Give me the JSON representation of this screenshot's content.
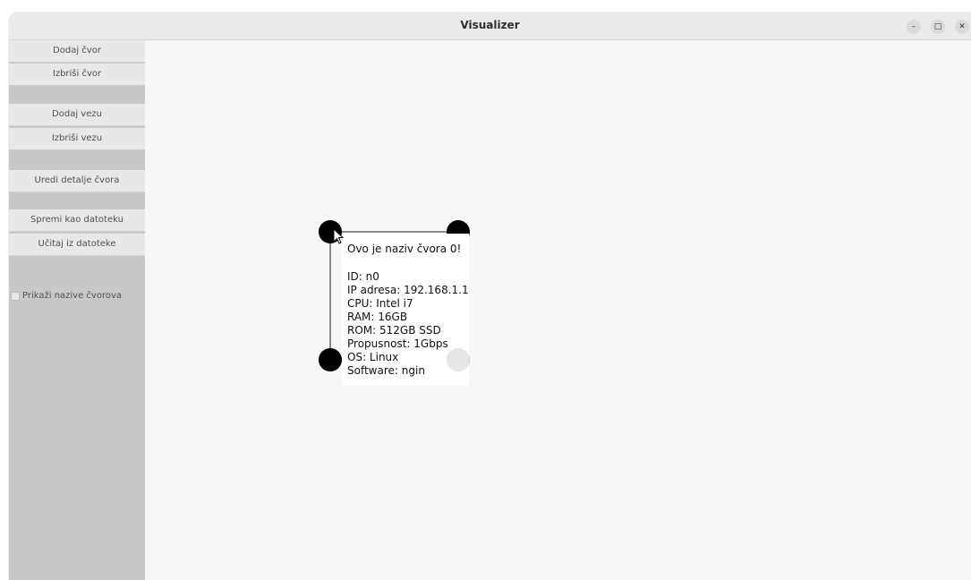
{
  "window": {
    "title": "Visualizer"
  },
  "window_controls": {
    "minimize": "–",
    "maximize": "□",
    "close": "✕"
  },
  "sidebar": {
    "buttons": [
      "Dodaj čvor",
      "Izbriši čvor",
      "Dodaj vezu",
      "Izbriši vezu",
      "Uredi detalje čvora",
      "Spremi kao datoteku",
      "Učitaj iz datoteke"
    ],
    "checkbox": {
      "label": "Prikaži nazive čvorova",
      "checked": false
    }
  },
  "graph": {
    "nodes": [
      {
        "name": "n0"
      },
      {
        "name": ""
      },
      {
        "name": ""
      },
      {
        "name": ""
      }
    ]
  },
  "tooltip": {
    "title": "Ovo je naziv čvora 0!",
    "id": "ID: n0",
    "ip": "IP adresa: 192.168.1.1",
    "cpu": "CPU: Intel i7",
    "ram": "RAM: 16GB",
    "rom": "ROM: 512GB SSD",
    "bandwidth": "Propusnost: 1Gbps",
    "os": "OS: Linux",
    "software": "Software: ngin"
  },
  "colors": {
    "node": "#000000",
    "node_selected": "#e6e6e6",
    "sidebar": "#c8c8c8"
  }
}
